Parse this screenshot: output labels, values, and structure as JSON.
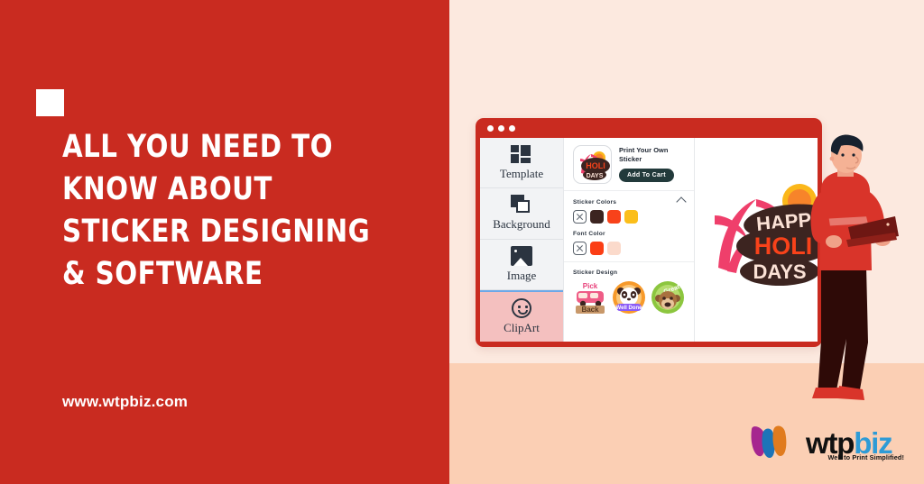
{
  "theme": {
    "red": "#C92B20",
    "cream": "#FCE9DF",
    "peach": "#FBCFB4",
    "white": "#FFFFFF",
    "sidebar_bg": "#F2F3F5",
    "active_item_bg": "#F4C0BF",
    "cart_btn_bg": "#223A3B",
    "logo_blue": "#2E9BD6"
  },
  "hero": {
    "headline_lines": [
      "ALL YOU NEED TO",
      "KNOW ABOUT",
      "STICKER DESIGNING",
      "& SOFTWARE"
    ],
    "url": "www.wtpbiz.com"
  },
  "browser": {
    "dots": [
      "dot-1",
      "dot-2",
      "dot-3"
    ]
  },
  "sidebar": {
    "items": [
      {
        "label": "Template",
        "icon": "template-icon",
        "active": false
      },
      {
        "label": "Background",
        "icon": "background-icon",
        "active": false
      },
      {
        "label": "Image",
        "icon": "image-icon",
        "active": false
      },
      {
        "label": "ClipArt",
        "icon": "clipart-smiley-icon",
        "active": true
      }
    ]
  },
  "panel": {
    "product": {
      "title": "Print Your Own Sticker",
      "thumb_alt": "happy-holidays-sticker-thumbnail",
      "cart_button": "Add To Cart"
    },
    "sticker_colors": {
      "title": "Sticker Colors",
      "collapse_icon": "chevron-up-icon",
      "swatches": [
        {
          "name": "none",
          "hex": "none"
        },
        {
          "name": "dark-brown",
          "hex": "#3C2420"
        },
        {
          "name": "orange-red",
          "hex": "#F8421A"
        },
        {
          "name": "golden-yellow",
          "hex": "#FBBE1A"
        }
      ]
    },
    "font_color": {
      "title": "Font Color",
      "swatches": [
        {
          "name": "none",
          "hex": "none"
        },
        {
          "name": "orange-red",
          "hex": "#FB3E15"
        },
        {
          "name": "pale-pink",
          "hex": "#FBDACB"
        }
      ]
    },
    "sticker_design": {
      "title": "Sticker Design",
      "items": [
        {
          "name": "pick-back-van-sticker",
          "caption_top": "Pick",
          "caption_bottom": "Back"
        },
        {
          "name": "panda-well-done-sticker",
          "caption": "Well Done"
        },
        {
          "name": "monkey-great-sticker",
          "caption": "Great"
        }
      ]
    }
  },
  "stage": {
    "artwork": {
      "name": "happy-holidays-sticker",
      "line1": "HAPPY",
      "line2": "HOLI",
      "line3": "DAYS"
    }
  },
  "illustration": {
    "name": "man-holding-laptop"
  },
  "logo": {
    "mark": "wtpbiz-w-mark",
    "text_wtp": "wtp",
    "text_biz": "biz",
    "tagline": "Web to Print Simplified!"
  }
}
